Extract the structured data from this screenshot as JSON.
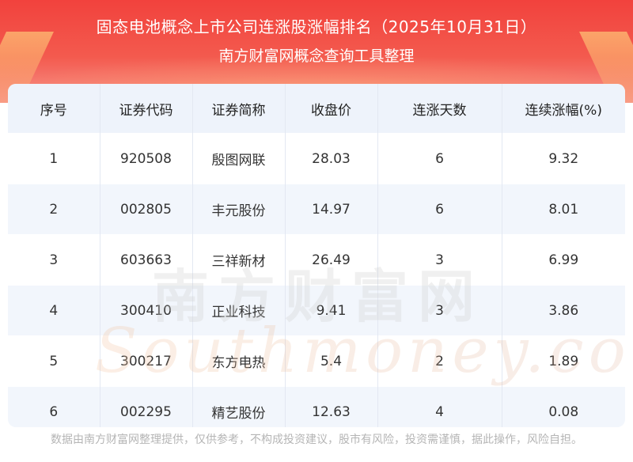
{
  "header": {
    "title": "固态电池概念上市公司连涨股涨幅排名（2025年10月31日）",
    "subtitle": "南方财富网概念查询工具整理"
  },
  "table": {
    "columns": [
      "序号",
      "证券代码",
      "证券简称",
      "收盘价",
      "连涨天数",
      "连续涨幅(%)"
    ],
    "rows": [
      {
        "rank": "1",
        "code": "920508",
        "name": "殷图网联",
        "close": "28.03",
        "days": "6",
        "gain": "9.32"
      },
      {
        "rank": "2",
        "code": "002805",
        "name": "丰元股份",
        "close": "14.97",
        "days": "6",
        "gain": "8.01"
      },
      {
        "rank": "3",
        "code": "603663",
        "name": "三祥新材",
        "close": "26.49",
        "days": "3",
        "gain": "6.99"
      },
      {
        "rank": "4",
        "code": "300410",
        "name": "正业科技",
        "close": "9.41",
        "days": "3",
        "gain": "3.86"
      },
      {
        "rank": "5",
        "code": "300217",
        "name": "东方电热",
        "close": "5.4",
        "days": "2",
        "gain": "1.89"
      },
      {
        "rank": "6",
        "code": "002295",
        "name": "精艺股份",
        "close": "12.63",
        "days": "4",
        "gain": "0.08"
      }
    ]
  },
  "watermark": {
    "cn": "南方财富网",
    "en": "Southmoney.com"
  },
  "footer": {
    "disclaimer": "数据由南方财富网整理提供，仅供参考，不构成投资建议，股市有风险，投资需谨慎，据此操作，风险自担。"
  },
  "colors": {
    "banner": "#f2423d",
    "header_row": "#eef3fb",
    "stripe_row": "#f0f4fb",
    "footer_text": "#b5b5b5",
    "watermark": "#d9a58c"
  }
}
